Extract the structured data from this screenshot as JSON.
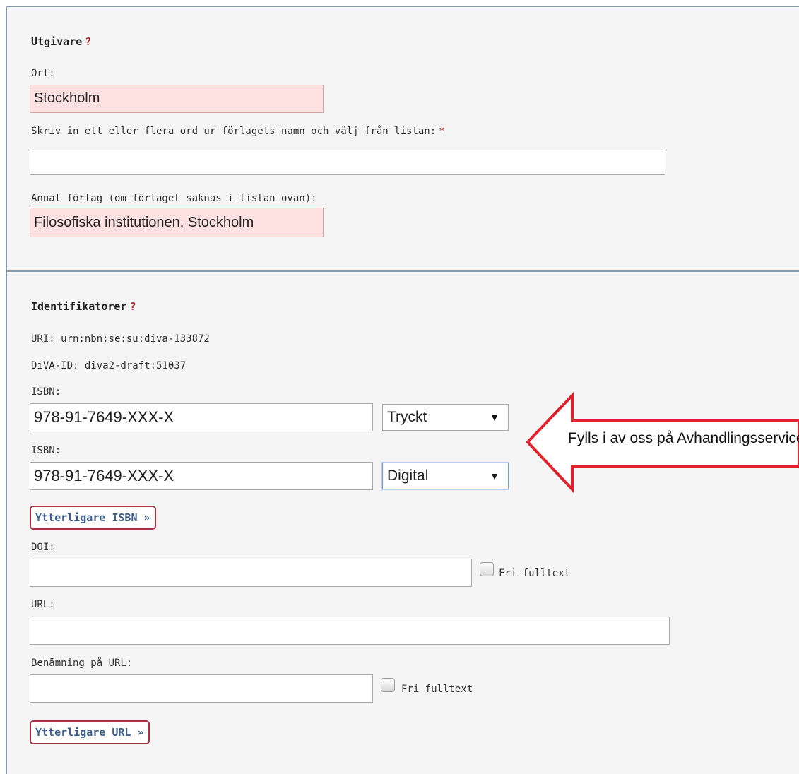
{
  "publisher": {
    "heading": "Utgivare",
    "help": "?",
    "city_label": "Ort:",
    "city_value": "Stockholm",
    "search_label": "Skriv in ett eller flera ord ur förlagets namn och välj från listan:",
    "required_mark": "*",
    "search_value": "",
    "other_label": "Annat förlag (om förlaget saknas i listan ovan):",
    "other_value": "Filosofiska institutionen, Stockholm"
  },
  "identifiers": {
    "heading": "Identifikatorer",
    "help": "?",
    "uri": "URI: urn:nbn:se:su:diva-133872",
    "diva_id": "DiVA-ID: diva2-draft:51037",
    "isbn": [
      {
        "label": "ISBN:",
        "value": "978-91-7649-XXX-X",
        "type": "Tryckt"
      },
      {
        "label": "ISBN:",
        "value": "978-91-7649-XXX-X",
        "type": "Digital"
      }
    ],
    "more_isbn_button": "Ytterligare ISBN »",
    "doi_label": "DOI:",
    "doi_value": "",
    "free_fulltext_label": "Fri fulltext",
    "url_label": "URL:",
    "url_value": "",
    "url_name_label": "Benämning på URL:",
    "url_name_value": "",
    "more_url_button": "Ytterligare URL »"
  },
  "annotation": {
    "text": "Fylls i av oss på Avhandlingsservice",
    "color": "#e0202a"
  },
  "icons": {
    "dropdown_caret": "▼"
  }
}
